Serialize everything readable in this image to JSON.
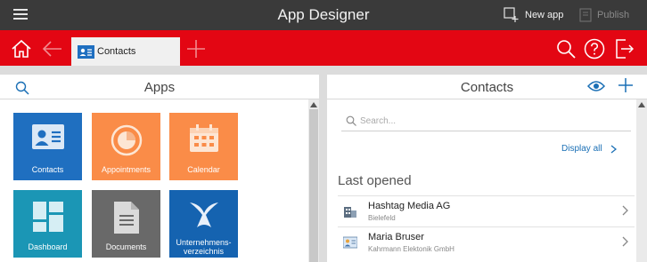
{
  "topbar": {
    "title": "App Designer",
    "new_app_label": "New app",
    "publish_label": "Publish",
    "menu_icon": "hamburger-menu-icon"
  },
  "toolbar": {
    "active_tab_label": "Contacts",
    "accent_color": "#e30613",
    "icons": [
      "home-icon",
      "back-arrow-icon",
      "add-tab-icon",
      "search-icon",
      "help-icon",
      "exit-icon"
    ]
  },
  "apps_panel": {
    "title": "Apps",
    "tiles": [
      {
        "label": "Contacts",
        "color": "#1f6fc0",
        "icon": "contact-card-icon"
      },
      {
        "label": "Appointments",
        "color": "#fa8c48",
        "icon": "appointment-disc-icon"
      },
      {
        "label": "Calendar",
        "color": "#fa8c48",
        "icon": "calendar-icon"
      },
      {
        "label": "Dashboard",
        "color": "#1b96b5",
        "icon": "dashboard-icon"
      },
      {
        "label": "Documents",
        "color": "#696969",
        "icon": "document-icon"
      },
      {
        "label_line1": "Unternehmens-",
        "label_line2": "verzeichnis",
        "color": "#1563b0",
        "icon": "company-directory-icon"
      }
    ]
  },
  "contacts_panel": {
    "title": "Contacts",
    "search_placeholder": "Search...",
    "display_all_label": "Display all",
    "last_opened_label": "Last opened",
    "items": [
      {
        "name": "Hashtag Media AG",
        "subtitle": "Bielefeld",
        "icon": "company-building-icon"
      },
      {
        "name": "Maria Bruser",
        "subtitle": "Kahrmann Elektonik GmbH",
        "icon": "person-card-icon"
      }
    ]
  }
}
